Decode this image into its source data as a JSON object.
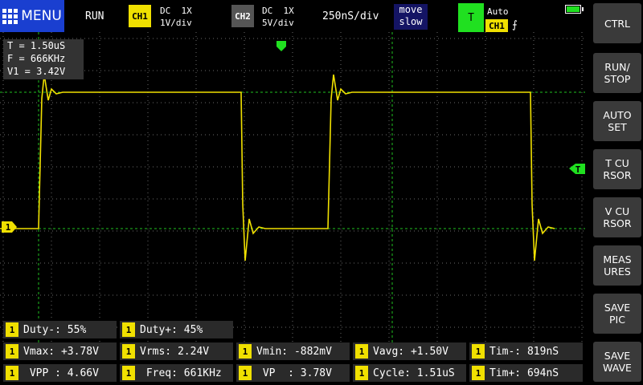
{
  "header": {
    "menu_label": "MENU",
    "run_state": "RUN",
    "ch1": {
      "name": "CH1",
      "coupling": "DC",
      "probe": "1X",
      "scale": "1V/div",
      "color": "#f0e000"
    },
    "ch2": {
      "name": "CH2",
      "coupling": "DC",
      "probe": "1X",
      "scale": "5V/div",
      "color": "#555555"
    },
    "timebase": "250nS/div",
    "move_label": "move",
    "move_speed": "slow",
    "trigger_label": "T",
    "trigger_mode": "Auto",
    "trigger_channel": "CH1",
    "trigger_edge": "⨍"
  },
  "info": {
    "period": "T = 1.50uS",
    "frequency": "F = 666KHz",
    "v1": "V1 = 3.42V"
  },
  "markers": {
    "channel_marker": "1",
    "trigger_level_marker": "T"
  },
  "sidebar": {
    "buttons": [
      {
        "label": "CTRL"
      },
      {
        "label": "RUN/\nSTOP"
      },
      {
        "label": "AUTO\nSET"
      },
      {
        "label": "T CU\nRSOR"
      },
      {
        "label": "V CU\nRSOR"
      },
      {
        "label": "MEAS\nURES"
      },
      {
        "label": "SAVE\nPIC"
      },
      {
        "label": "SAVE\nWAVE"
      }
    ]
  },
  "measurements": {
    "badge": "1",
    "row0": [
      "Duty-: 55%",
      "Duty+: 45%"
    ],
    "row1": [
      "Vmax: +3.78V",
      "Vrms: 2.24V",
      "Vmin: -882mV",
      "Vavg: +1.50V",
      "Tim-: 819nS"
    ],
    "row2": [
      " VPP : 4.66V",
      " Freq: 661KHz",
      " VP  : 3.78V",
      "Cycle: 1.51uS",
      "Tim+: 694nS"
    ]
  },
  "colors": {
    "trace": "#f0e000",
    "grid": "#6a6a6a",
    "cursor_lines": "#20c020",
    "menu_bg": "#1a3fd0",
    "trigger_bg": "#20e020"
  },
  "waveform": {
    "low_volts": 0.0,
    "high_volts": 3.42,
    "period_us": 1.5,
    "timebase_ns_per_div": 250
  }
}
